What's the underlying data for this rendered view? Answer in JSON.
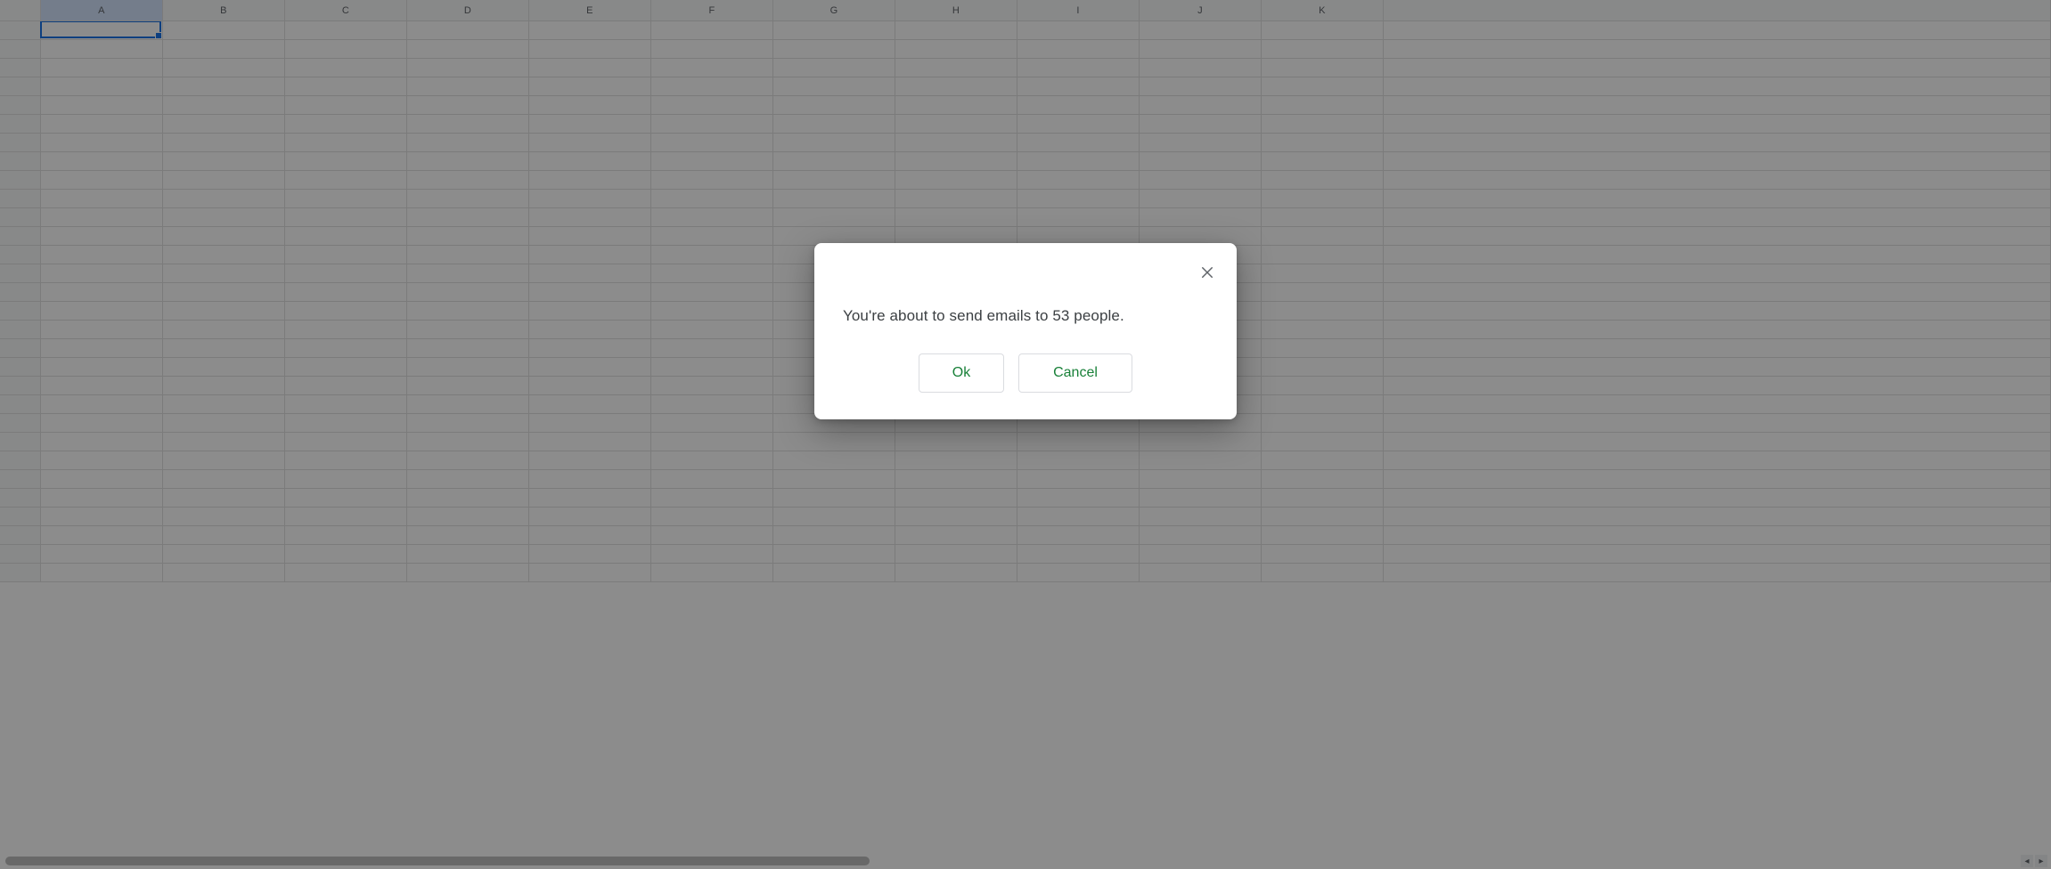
{
  "spreadsheet": {
    "columns": [
      "A",
      "B",
      "C",
      "D",
      "E",
      "F",
      "G",
      "H",
      "I",
      "J",
      "K"
    ],
    "row_count": 30,
    "selected_column_index": 0,
    "active_cell": {
      "col": 0,
      "row": 0
    }
  },
  "dialog": {
    "message": "You're about to send emails to 53 people.",
    "ok_label": "Ok",
    "cancel_label": "Cancel"
  }
}
